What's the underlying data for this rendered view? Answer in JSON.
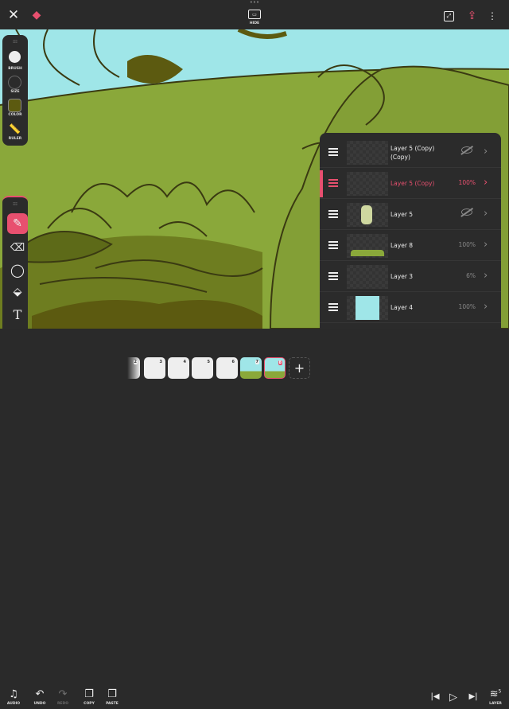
{
  "topbar": {
    "hide_label": "HIDE"
  },
  "left_toolbar": {
    "items": [
      {
        "label": "BRUSH"
      },
      {
        "label": "SIZE"
      },
      {
        "label": "COLOR"
      },
      {
        "label": "RULER"
      }
    ],
    "current_color": "#5c5a10"
  },
  "tools": [
    "brush",
    "eraser",
    "lasso",
    "fill",
    "text",
    "more"
  ],
  "layers": [
    {
      "name": "Layer 5 (Copy) (Copy)",
      "opacity": "",
      "hidden": true,
      "selected": false
    },
    {
      "name": "Layer 5 (Copy)",
      "opacity": "100%",
      "hidden": false,
      "selected": true
    },
    {
      "name": "Layer 5",
      "opacity": "",
      "hidden": true,
      "selected": false
    },
    {
      "name": "Layer 8",
      "opacity": "100%",
      "hidden": false,
      "selected": false
    },
    {
      "name": "Layer 3",
      "opacity": "6%",
      "hidden": false,
      "selected": false
    },
    {
      "name": "Layer 4",
      "opacity": "100%",
      "hidden": false,
      "selected": false
    }
  ],
  "bottom": {
    "audio": "AUDIO",
    "undo": "UNDO",
    "redo": "REDO",
    "copy": "COPY",
    "paste": "PASTE",
    "layer": "LAYER",
    "layer_count": "5"
  },
  "frames": [
    "2",
    "3",
    "4",
    "5",
    "6",
    "7",
    "8"
  ],
  "selected_frame": "8",
  "colors": {
    "accent": "#e8506f",
    "sky": "#9fe6e8",
    "grass": "#8aa83a",
    "ink": "#4a4a14"
  }
}
